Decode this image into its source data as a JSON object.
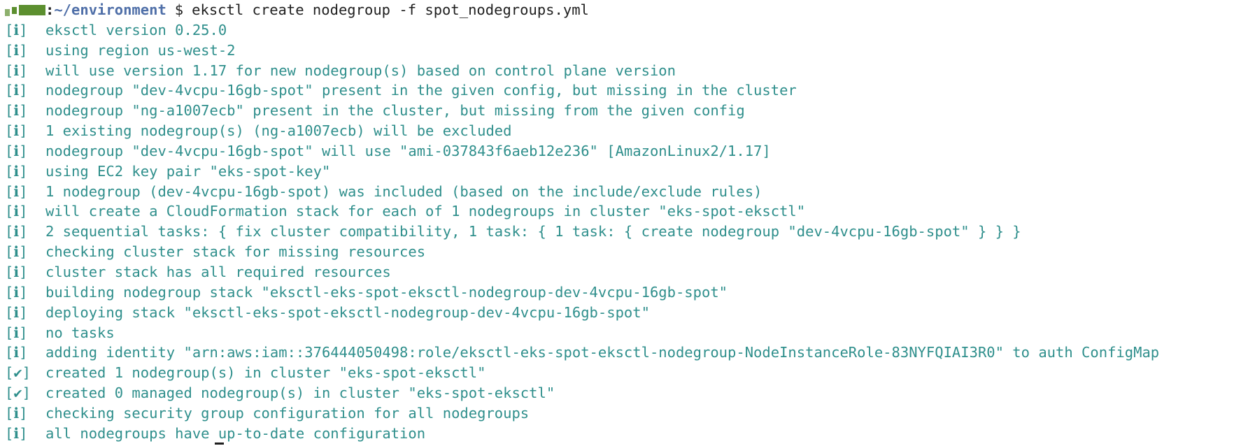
{
  "prompt": {
    "path": "~/environment",
    "dollar": "$",
    "command": "eksctl create nodegroup -f spot_nodegroups.yml"
  },
  "lines": [
    {
      "status": "[ℹ]",
      "text": "eksctl version 0.25.0"
    },
    {
      "status": "[ℹ]",
      "text": "using region us-west-2"
    },
    {
      "status": "[ℹ]",
      "text": "will use version 1.17 for new nodegroup(s) based on control plane version"
    },
    {
      "status": "[ℹ]",
      "text": "nodegroup \"dev-4vcpu-16gb-spot\" present in the given config, but missing in the cluster"
    },
    {
      "status": "[ℹ]",
      "text": "nodegroup \"ng-a1007ecb\" present in the cluster, but missing from the given config"
    },
    {
      "status": "[ℹ]",
      "text": "1 existing nodegroup(s) (ng-a1007ecb) will be excluded"
    },
    {
      "status": "[ℹ]",
      "text": "nodegroup \"dev-4vcpu-16gb-spot\" will use \"ami-037843f6aeb12e236\" [AmazonLinux2/1.17]"
    },
    {
      "status": "[ℹ]",
      "text": "using EC2 key pair \"eks-spot-key\""
    },
    {
      "status": "[ℹ]",
      "text": "1 nodegroup (dev-4vcpu-16gb-spot) was included (based on the include/exclude rules)"
    },
    {
      "status": "[ℹ]",
      "text": "will create a CloudFormation stack for each of 1 nodegroups in cluster \"eks-spot-eksctl\""
    },
    {
      "status": "[ℹ]",
      "text": "2 sequential tasks: { fix cluster compatibility, 1 task: { 1 task: { create nodegroup \"dev-4vcpu-16gb-spot\" } } }"
    },
    {
      "status": "[ℹ]",
      "text": "checking cluster stack for missing resources"
    },
    {
      "status": "[ℹ]",
      "text": "cluster stack has all required resources"
    },
    {
      "status": "[ℹ]",
      "text": "building nodegroup stack \"eksctl-eks-spot-eksctl-nodegroup-dev-4vcpu-16gb-spot\""
    },
    {
      "status": "[ℹ]",
      "text": "deploying stack \"eksctl-eks-spot-eksctl-nodegroup-dev-4vcpu-16gb-spot\""
    },
    {
      "status": "[ℹ]",
      "text": "no tasks"
    },
    {
      "status": "[ℹ]",
      "text": "adding identity \"arn:aws:iam::376444050498:role/eksctl-eks-spot-eksctl-nodegroup-NodeInstanceRole-83NYFQIAI3R0\" to auth ConfigMap"
    },
    {
      "status": "[✔]",
      "text": "created 1 nodegroup(s) in cluster \"eks-spot-eksctl\""
    },
    {
      "status": "[✔]",
      "text": "created 0 managed nodegroup(s) in cluster \"eks-spot-eksctl\""
    },
    {
      "status": "[ℹ]",
      "text": "checking security group configuration for all nodegroups"
    },
    {
      "status": "[ℹ]",
      "text": "all nodegroups have up-to-date configuration"
    }
  ],
  "colors": {
    "output_text": "#2f8f8c",
    "prompt_path": "#4f6fa8",
    "host_block": "#5c8f2f",
    "command_text": "#1f1f1f",
    "background": "#ffffff"
  }
}
